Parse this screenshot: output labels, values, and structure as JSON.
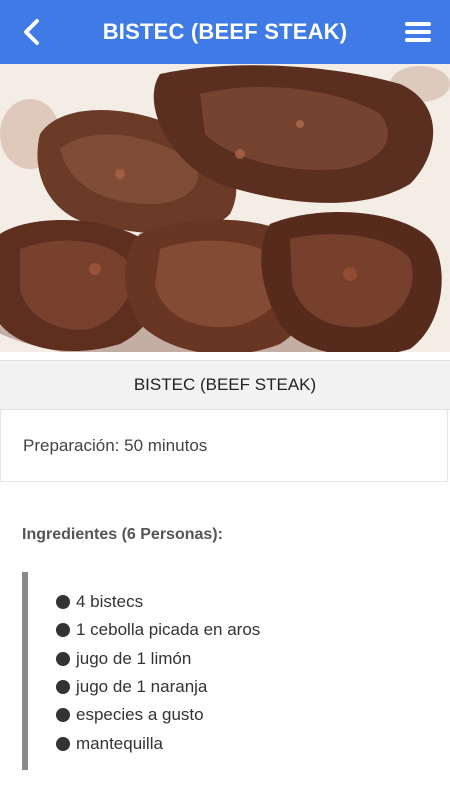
{
  "header": {
    "title": "BISTEC (BEEF STEAK)",
    "back_icon": "chevron-left-icon",
    "menu_icon": "hamburger-menu-icon",
    "bar_color": "#3f7ae6"
  },
  "recipe": {
    "name": "BISTEC (BEEF STEAK)",
    "preparation": "Preparación: 50 minutos",
    "ingredients_heading": "Ingredientes (6 Personas):",
    "ingredients": [
      "4 bistecs",
      "1 cebolla picada en aros",
      "jugo de 1 limón",
      "jugo de 1 naranja",
      "especies a gusto",
      "mantequilla"
    ]
  }
}
